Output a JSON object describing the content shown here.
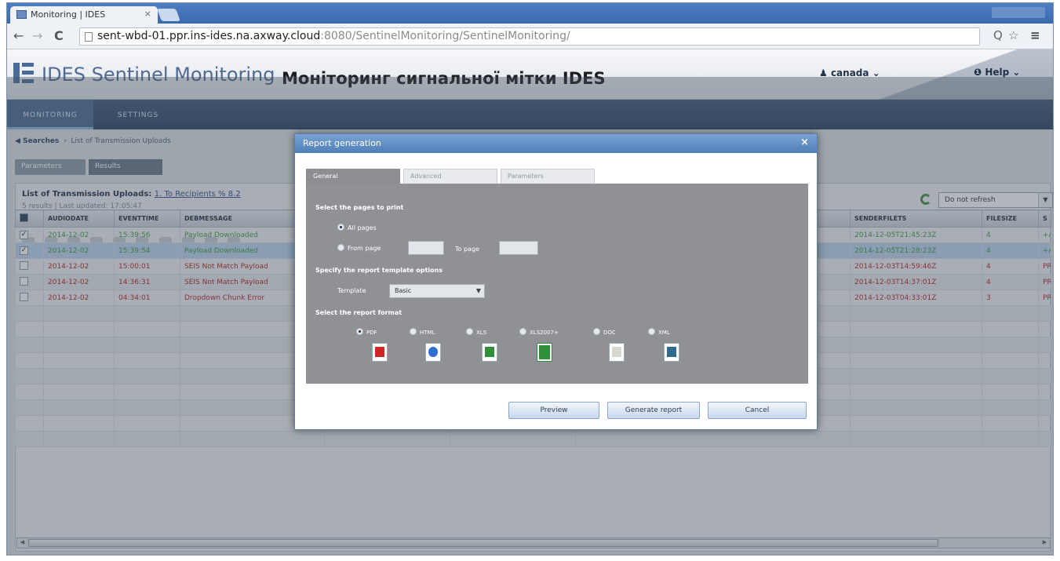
{
  "browser": {
    "tab_title": "Monitoring | IDES",
    "tab_close": "×",
    "url_host": "sent-wbd-01.ppr.ins-ides.na.axway.cloud",
    "url_path": ":8080/SentinelMonitoring/SentinelMonitoring/",
    "back_icon": "back-arrow-icon",
    "forward_icon": "forward-arrow-icon",
    "reload_label": "C",
    "star": "☆",
    "menu": "≡"
  },
  "header": {
    "app_title": "IDES Sentinel Monitoring",
    "overlay_caption": "Моніторинг сигнальної мітки IDES",
    "user_label": "canada",
    "help_label": "Help"
  },
  "menubar": {
    "tabs": [
      {
        "label": "MONITORING"
      },
      {
        "label": "SETTINGS"
      }
    ]
  },
  "list": {
    "title": "List of Transmission Uploads:",
    "title_link": "1. To Recipients % 8.2",
    "subtitle": "5 results | Last updated: 17:05:47",
    "refresh_option": "Do not refresh",
    "columns": [
      "AUDIODATE",
      "EVENTTIME",
      "DEBMESSAGE",
      "",
      "",
      "",
      "SENDERFILETS",
      "FILESIZE",
      "S"
    ],
    "rows": [
      {
        "status": "ok",
        "checked": true,
        "date": "2014-12-02",
        "time": "15:39:56",
        "message": "Payload Downloaded",
        "ts": "2014-12-05T21:45:23Z",
        "size": "4",
        "s": "+A"
      },
      {
        "status": "sel",
        "checked": true,
        "date": "2014-12-02",
        "time": "15:39:54",
        "message": "Payload Downloaded",
        "ts": "2014-12-05T21:28:23Z",
        "size": "4",
        "s": "+A"
      },
      {
        "status": "bad",
        "checked": false,
        "date": "2014-12-02",
        "time": "15:00:01",
        "message": "SEIS Not Match Payload",
        "ts": "2014-12-03T14:59:46Z",
        "size": "4",
        "s": "PR"
      },
      {
        "status": "bad",
        "checked": false,
        "date": "2014-12-02",
        "time": "14:36:31",
        "message": "SEIS Not Match Payload",
        "ts": "2014-12-03T14:37:01Z",
        "size": "4",
        "s": "PR"
      },
      {
        "status": "bad",
        "checked": false,
        "date": "2014-12-02",
        "time": "04:34:01",
        "message": "Dropdown Chunk Error",
        "ts": "2014-12-03T04:33:01Z",
        "size": "3",
        "s": "PR"
      }
    ]
  },
  "dialog": {
    "title": "Report generation",
    "close": "×",
    "tabs": [
      "General",
      "Advanced",
      "Parameters"
    ],
    "pages_heading": "Select the pages to print",
    "all_pages": "All pages",
    "from_page": "From page",
    "to_page": "To page",
    "template_heading": "Specify the report template options",
    "template_label": "Template",
    "template_value": "Basic",
    "format_heading": "Select the report format",
    "formats": [
      "PDF",
      "HTML",
      "XLS",
      "XLS2007+",
      "DOC",
      "XML"
    ],
    "buttons": {
      "preview": "Preview",
      "generate": "Generate report",
      "cancel": "Cancel"
    }
  },
  "colors": {
    "accent": "#4f7fb8",
    "ok_text": "#3c9a3c",
    "error_text": "#b51d1d",
    "selected_row": "#bcd4ee"
  }
}
